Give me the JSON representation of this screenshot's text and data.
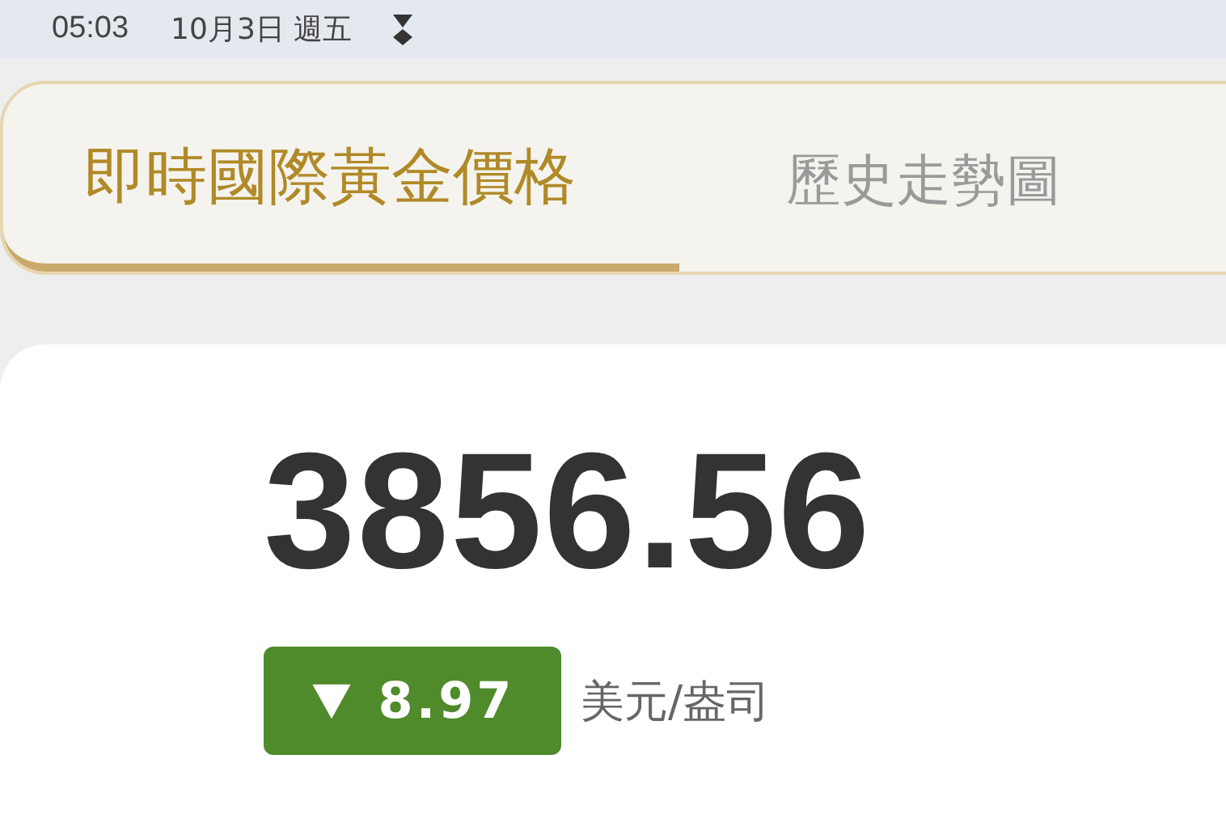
{
  "status_bar": {
    "time": "05:03",
    "date": "10月3日 週五"
  },
  "tabs": [
    {
      "label": "即時國際黃金價格",
      "selected": true
    },
    {
      "label": "歷史走勢圖",
      "selected": false
    }
  ],
  "price_card": {
    "price": "3856.56",
    "change": {
      "kind": "down",
      "value": "8.97"
    },
    "unit": "美元/盎司"
  }
}
